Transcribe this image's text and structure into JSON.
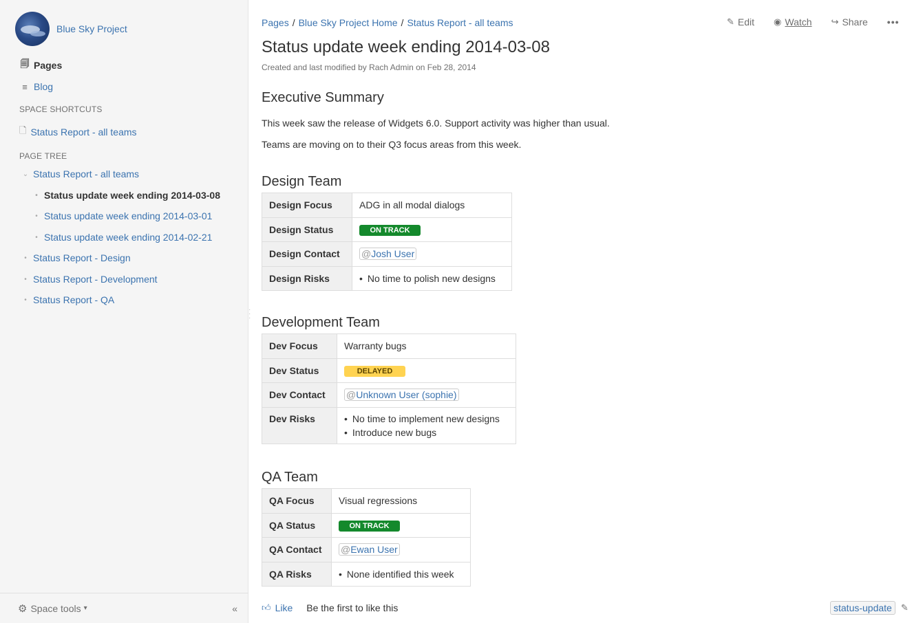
{
  "sidebar": {
    "space_name": "Blue Sky Project",
    "pages_label": "Pages",
    "blog_label": "Blog",
    "shortcuts_title": "SPACE SHORTCUTS",
    "shortcut_label": "Status Report - all teams",
    "tree_title": "PAGE TREE",
    "tree": [
      {
        "label": "Status Report - all teams",
        "level": 0,
        "expanded": true,
        "current": false
      },
      {
        "label": "Status update week ending 2014-03-08",
        "level": 1,
        "current": true
      },
      {
        "label": "Status update week ending 2014-03-01",
        "level": 1,
        "current": false
      },
      {
        "label": "Status update week ending 2014-02-21",
        "level": 1,
        "current": false
      },
      {
        "label": "Status Report - Design",
        "level": 0,
        "current": false
      },
      {
        "label": "Status Report - Development",
        "level": 0,
        "current": false
      },
      {
        "label": "Status Report - QA",
        "level": 0,
        "current": false
      }
    ],
    "space_tools_label": "Space tools",
    "collapse_label": "«"
  },
  "breadcrumb": [
    "Pages",
    "Blue Sky Project Home",
    "Status Report - all teams"
  ],
  "actions": {
    "edit": "Edit",
    "watch": "Watch",
    "share": "Share",
    "more": "•••"
  },
  "page": {
    "title": "Status update week ending 2014-03-08",
    "meta": "Created and last modified by Rach Admin on Feb 28, 2014",
    "summary_heading": "Executive Summary",
    "summary_p1": "This week saw the release of Widgets 6.0.  Support activity was higher than usual.",
    "summary_p2": "Teams are moving on to their Q3 focus areas from this week."
  },
  "teams": {
    "design": {
      "heading": "Design Team",
      "focus_label": "Design Focus",
      "focus": "ADG in all modal dialogs",
      "status_label": "Design Status",
      "status": "ON TRACK",
      "contact_label": "Design Contact",
      "contact": "Josh User",
      "risks_label": "Design Risks",
      "risks": [
        "No time to polish new designs"
      ]
    },
    "dev": {
      "heading": "Development Team",
      "focus_label": "Dev Focus",
      "focus": "Warranty bugs",
      "status_label": "Dev Status",
      "status": "DELAYED",
      "contact_label": "Dev Contact",
      "contact": "Unknown User (sophie)",
      "risks_label": "Dev Risks",
      "risks": [
        "No time to implement new designs",
        "Introduce new bugs"
      ]
    },
    "qa": {
      "heading": "QA Team",
      "focus_label": "QA Focus",
      "focus": "Visual regressions",
      "status_label": "QA Status",
      "status": "ON TRACK",
      "contact_label": "QA Contact",
      "contact": "Ewan User",
      "risks_label": "QA Risks",
      "risks": [
        "None identified this week"
      ]
    }
  },
  "footer": {
    "like_label": "Like",
    "like_text": "Be the first to like this",
    "label_tag": "status-update"
  },
  "colors": {
    "link": "#3b73af",
    "on_track": "#14892c",
    "delayed": "#ffd351"
  }
}
